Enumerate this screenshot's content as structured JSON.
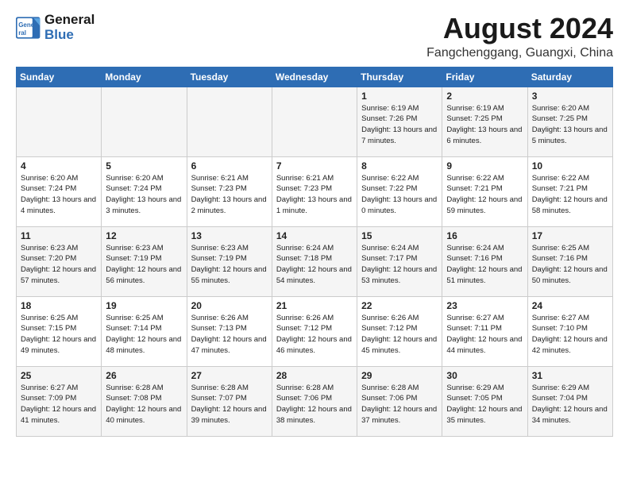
{
  "logo": {
    "line1": "General",
    "line2": "Blue"
  },
  "title": "August 2024",
  "subtitle": "Fangchenggang, Guangxi, China",
  "days_of_week": [
    "Sunday",
    "Monday",
    "Tuesday",
    "Wednesday",
    "Thursday",
    "Friday",
    "Saturday"
  ],
  "weeks": [
    [
      {
        "day": "",
        "info": ""
      },
      {
        "day": "",
        "info": ""
      },
      {
        "day": "",
        "info": ""
      },
      {
        "day": "",
        "info": ""
      },
      {
        "day": "1",
        "info": "Sunrise: 6:19 AM\nSunset: 7:26 PM\nDaylight: 13 hours and 7 minutes."
      },
      {
        "day": "2",
        "info": "Sunrise: 6:19 AM\nSunset: 7:25 PM\nDaylight: 13 hours and 6 minutes."
      },
      {
        "day": "3",
        "info": "Sunrise: 6:20 AM\nSunset: 7:25 PM\nDaylight: 13 hours and 5 minutes."
      }
    ],
    [
      {
        "day": "4",
        "info": "Sunrise: 6:20 AM\nSunset: 7:24 PM\nDaylight: 13 hours and 4 minutes."
      },
      {
        "day": "5",
        "info": "Sunrise: 6:20 AM\nSunset: 7:24 PM\nDaylight: 13 hours and 3 minutes."
      },
      {
        "day": "6",
        "info": "Sunrise: 6:21 AM\nSunset: 7:23 PM\nDaylight: 13 hours and 2 minutes."
      },
      {
        "day": "7",
        "info": "Sunrise: 6:21 AM\nSunset: 7:23 PM\nDaylight: 13 hours and 1 minute."
      },
      {
        "day": "8",
        "info": "Sunrise: 6:22 AM\nSunset: 7:22 PM\nDaylight: 13 hours and 0 minutes."
      },
      {
        "day": "9",
        "info": "Sunrise: 6:22 AM\nSunset: 7:21 PM\nDaylight: 12 hours and 59 minutes."
      },
      {
        "day": "10",
        "info": "Sunrise: 6:22 AM\nSunset: 7:21 PM\nDaylight: 12 hours and 58 minutes."
      }
    ],
    [
      {
        "day": "11",
        "info": "Sunrise: 6:23 AM\nSunset: 7:20 PM\nDaylight: 12 hours and 57 minutes."
      },
      {
        "day": "12",
        "info": "Sunrise: 6:23 AM\nSunset: 7:19 PM\nDaylight: 12 hours and 56 minutes."
      },
      {
        "day": "13",
        "info": "Sunrise: 6:23 AM\nSunset: 7:19 PM\nDaylight: 12 hours and 55 minutes."
      },
      {
        "day": "14",
        "info": "Sunrise: 6:24 AM\nSunset: 7:18 PM\nDaylight: 12 hours and 54 minutes."
      },
      {
        "day": "15",
        "info": "Sunrise: 6:24 AM\nSunset: 7:17 PM\nDaylight: 12 hours and 53 minutes."
      },
      {
        "day": "16",
        "info": "Sunrise: 6:24 AM\nSunset: 7:16 PM\nDaylight: 12 hours and 51 minutes."
      },
      {
        "day": "17",
        "info": "Sunrise: 6:25 AM\nSunset: 7:16 PM\nDaylight: 12 hours and 50 minutes."
      }
    ],
    [
      {
        "day": "18",
        "info": "Sunrise: 6:25 AM\nSunset: 7:15 PM\nDaylight: 12 hours and 49 minutes."
      },
      {
        "day": "19",
        "info": "Sunrise: 6:25 AM\nSunset: 7:14 PM\nDaylight: 12 hours and 48 minutes."
      },
      {
        "day": "20",
        "info": "Sunrise: 6:26 AM\nSunset: 7:13 PM\nDaylight: 12 hours and 47 minutes."
      },
      {
        "day": "21",
        "info": "Sunrise: 6:26 AM\nSunset: 7:12 PM\nDaylight: 12 hours and 46 minutes."
      },
      {
        "day": "22",
        "info": "Sunrise: 6:26 AM\nSunset: 7:12 PM\nDaylight: 12 hours and 45 minutes."
      },
      {
        "day": "23",
        "info": "Sunrise: 6:27 AM\nSunset: 7:11 PM\nDaylight: 12 hours and 44 minutes."
      },
      {
        "day": "24",
        "info": "Sunrise: 6:27 AM\nSunset: 7:10 PM\nDaylight: 12 hours and 42 minutes."
      }
    ],
    [
      {
        "day": "25",
        "info": "Sunrise: 6:27 AM\nSunset: 7:09 PM\nDaylight: 12 hours and 41 minutes."
      },
      {
        "day": "26",
        "info": "Sunrise: 6:28 AM\nSunset: 7:08 PM\nDaylight: 12 hours and 40 minutes."
      },
      {
        "day": "27",
        "info": "Sunrise: 6:28 AM\nSunset: 7:07 PM\nDaylight: 12 hours and 39 minutes."
      },
      {
        "day": "28",
        "info": "Sunrise: 6:28 AM\nSunset: 7:06 PM\nDaylight: 12 hours and 38 minutes."
      },
      {
        "day": "29",
        "info": "Sunrise: 6:28 AM\nSunset: 7:06 PM\nDaylight: 12 hours and 37 minutes."
      },
      {
        "day": "30",
        "info": "Sunrise: 6:29 AM\nSunset: 7:05 PM\nDaylight: 12 hours and 35 minutes."
      },
      {
        "day": "31",
        "info": "Sunrise: 6:29 AM\nSunset: 7:04 PM\nDaylight: 12 hours and 34 minutes."
      }
    ]
  ]
}
